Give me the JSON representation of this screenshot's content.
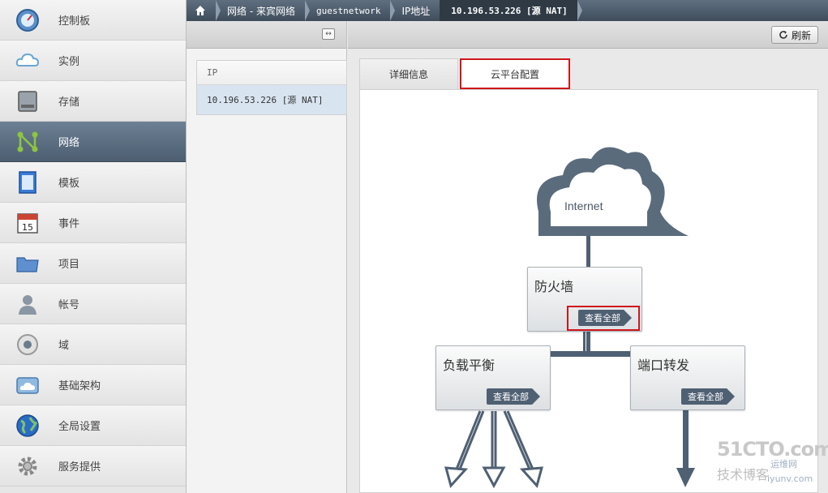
{
  "sidebar": {
    "items": [
      {
        "label": "控制板",
        "icon": "dashboard-icon",
        "active": false
      },
      {
        "label": "实例",
        "icon": "cloud-icon",
        "active": false
      },
      {
        "label": "存储",
        "icon": "storage-icon",
        "active": false
      },
      {
        "label": "网络",
        "icon": "network-icon",
        "active": true
      },
      {
        "label": "模板",
        "icon": "template-icon",
        "active": false
      },
      {
        "label": "事件",
        "icon": "calendar-icon",
        "active": false
      },
      {
        "label": "项目",
        "icon": "folder-icon",
        "active": false
      },
      {
        "label": "帐号",
        "icon": "user-icon",
        "active": false
      },
      {
        "label": "域",
        "icon": "domain-icon",
        "active": false
      },
      {
        "label": "基础架构",
        "icon": "infrastructure-icon",
        "active": false
      },
      {
        "label": "全局设置",
        "icon": "globe-icon",
        "active": false
      },
      {
        "label": "服务提供",
        "icon": "gear-icon",
        "active": false
      }
    ]
  },
  "breadcrumb": {
    "items": [
      "网络 - 来宾网络",
      "guestnetwork",
      "IP地址",
      "10.196.53.226 [源 NAT]"
    ]
  },
  "list": {
    "header": "IP",
    "rows": [
      "10.196.53.226 [源 NAT]"
    ]
  },
  "toolbar": {
    "refresh_label": "刷新"
  },
  "tabs": [
    "详细信息",
    "云平台配置"
  ],
  "diagram": {
    "internet_label": "Internet",
    "firewall": {
      "title": "防火墙",
      "button": "查看全部"
    },
    "load_balancer": {
      "title": "负载平衡",
      "button": "查看全部"
    },
    "port_forwarding": {
      "title": "端口转发",
      "button": "查看全部"
    }
  },
  "watermark": {
    "line1": "51CTO.com",
    "line2": "技术博客",
    "line3": "运维网",
    "line4": "iyunv.com"
  },
  "colors": {
    "highlight": "#d0161c",
    "active_nav": "#5a6d80",
    "diagram": "#4f6073"
  }
}
